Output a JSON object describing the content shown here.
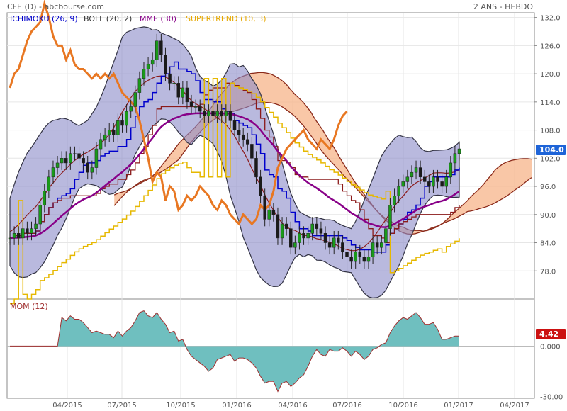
{
  "header": {
    "title": "CFE (D) - abcbourse.com",
    "period": "2 ANS - HEBDO"
  },
  "legend": [
    {
      "label": "ICHIMOKU (26, 9)",
      "color": "#0000cc"
    },
    {
      "label": "BOLL (20, 2)",
      "color": "#333333"
    },
    {
      "label": "MME (30)",
      "color": "#880088"
    },
    {
      "label": "SUPERTREND (10, 3)",
      "color": "#e6a800"
    }
  ],
  "momentum_label": "MOM (12)",
  "colors": {
    "bollinger_fill": "#8a8ac8",
    "cloud_fill": "#f7b48a",
    "cloud_border": "#8b2a1a",
    "ichimoku_tenkan": "#0000cc",
    "ichimoku_kijun": "#8b1a1a",
    "chikou": "#e87722",
    "chikou_late": "#c8601a",
    "ema": "#880088",
    "supertrend": "#e6b800",
    "supertrend_low": "#808000",
    "candle_up": "#1a9a1a",
    "candle_down": "#1a1a1a",
    "momentum_fill": "#6fbfbf",
    "momentum_line": "#a03030",
    "last_price_bg": "#1e64d8",
    "last_mom_bg": "#cc1111"
  },
  "chart_data": {
    "type": "candlestick",
    "x_tick_labels": [
      "04/2015",
      "07/2015",
      "10/2015",
      "01/2016",
      "04/2016",
      "07/2016",
      "10/2016",
      "01/2017",
      "04/2017"
    ],
    "price_axis": {
      "ticks": [
        "132.0",
        "126.0",
        "120.0",
        "114.0",
        "108.0",
        "102.0",
        "96.0",
        "90.0",
        "84.0",
        "78.0"
      ],
      "ylim": [
        72,
        133
      ],
      "last_price": "104.0"
    },
    "momentum_axis": {
      "ticks": [
        "4.42",
        "0.000",
        "-30.00"
      ],
      "ylim": [
        -31,
        28
      ],
      "last_value": "4.42"
    },
    "closes": [
      85,
      86,
      85,
      87,
      86,
      87,
      88,
      92,
      95,
      98,
      100,
      101,
      102,
      101,
      103,
      103,
      102,
      101,
      99,
      100,
      104,
      106,
      107,
      108,
      107,
      110,
      109,
      112,
      113,
      116,
      119,
      121,
      122,
      123,
      127,
      124,
      120,
      118,
      118,
      115,
      117,
      114,
      113,
      113,
      112,
      111,
      112,
      111,
      112,
      111,
      112,
      110,
      108,
      107,
      106,
      105,
      102,
      98,
      94,
      89,
      91,
      90,
      85,
      88,
      87,
      83,
      84,
      86,
      85,
      86,
      88,
      87,
      86,
      84,
      83,
      85,
      84,
      82,
      81,
      80,
      82,
      81,
      80,
      81,
      84,
      83,
      84,
      87,
      92,
      94,
      96,
      97,
      98,
      99,
      100,
      98,
      97,
      96,
      98,
      97,
      96,
      98,
      101,
      103,
      104
    ]
  }
}
